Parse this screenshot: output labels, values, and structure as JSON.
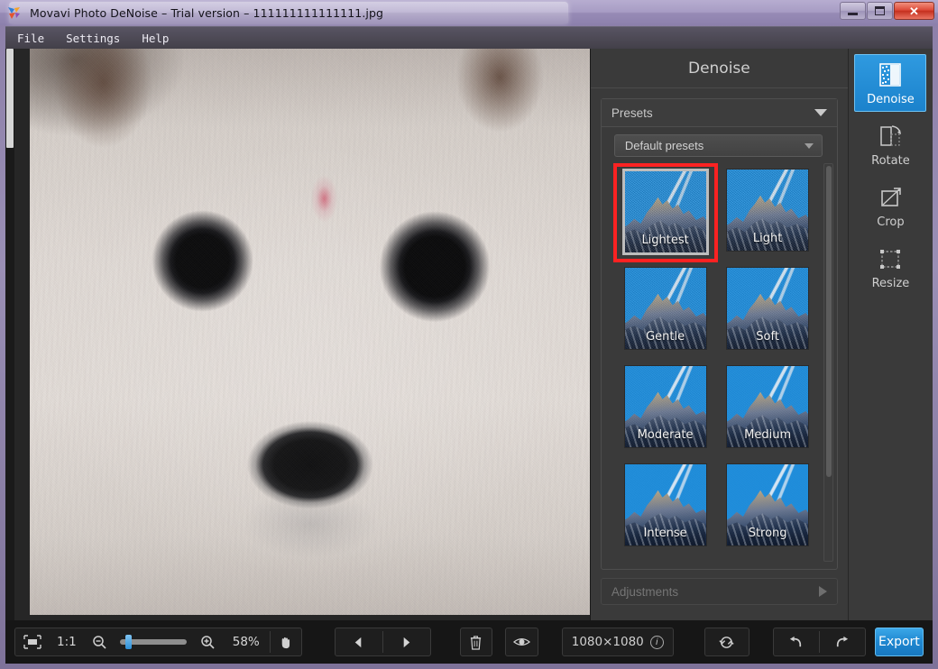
{
  "window": {
    "title": "Movavi Photo DeNoise – Trial version – 111111111111111.jpg",
    "app_icon": "movavi-logo-icon",
    "controls": {
      "minimize": "minimize-icon",
      "maximize": "maximize-icon",
      "close": "✕"
    }
  },
  "menu": {
    "items": [
      {
        "label": "File"
      },
      {
        "label": "Settings"
      },
      {
        "label": "Help"
      }
    ]
  },
  "panel": {
    "title": "Denoise",
    "presets_header": "Presets",
    "preset_category": "Default presets",
    "adjustments": "Adjustments",
    "presets": [
      {
        "label": "Lightest",
        "selected": true
      },
      {
        "label": "Light",
        "selected": false
      },
      {
        "label": "Gentle",
        "selected": false
      },
      {
        "label": "Soft",
        "selected": false
      },
      {
        "label": "Moderate",
        "selected": false
      },
      {
        "label": "Medium",
        "selected": false
      },
      {
        "label": "Intense",
        "selected": false
      },
      {
        "label": "Strong",
        "selected": false
      }
    ]
  },
  "tools": [
    {
      "label": "Denoise",
      "icon": "denoise-icon",
      "active": true
    },
    {
      "label": "Rotate",
      "icon": "rotate-icon",
      "active": false
    },
    {
      "label": "Crop",
      "icon": "crop-icon",
      "active": false
    },
    {
      "label": "Resize",
      "icon": "resize-icon",
      "active": false
    }
  ],
  "bottom_bar": {
    "fit_icon": "fit-to-screen-icon",
    "actual_size_label": "1:1",
    "zoom_out_icon": "zoom-out-icon",
    "zoom_in_icon": "zoom-in-icon",
    "zoom_value": "58%",
    "pan_icon": "hand-pan-icon",
    "prev_icon": "previous-image-icon",
    "next_icon": "next-image-icon",
    "delete_icon": "trash-icon",
    "compare_icon": "eye-compare-icon",
    "resolution": "1080×1080",
    "info_icon": "i",
    "reset_icon": "reset-icon",
    "undo_icon": "undo-icon",
    "redo_icon": "redo-icon",
    "export_label": "Export"
  },
  "colors": {
    "accent": "#1e86cf",
    "selection_highlight": "#fc2222",
    "panel_bg": "#3a3a3a",
    "canvas_bg": "#262626",
    "bar_bg": "#161616"
  }
}
